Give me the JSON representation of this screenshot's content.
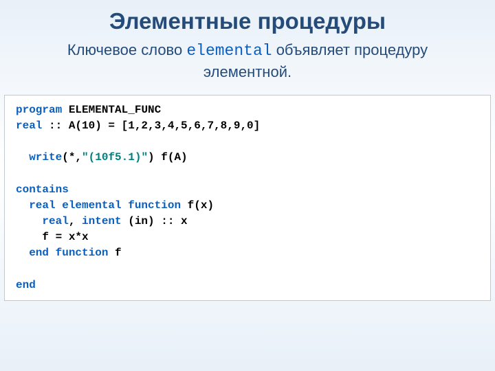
{
  "title": "Элементные процедуры",
  "subtitle_pre": "Ключевое слово ",
  "subtitle_kw": "elemental",
  "subtitle_post": "  объявляет процедуру элементной.",
  "code": {
    "l1a": "program",
    "l1b": " ELEMENTAL_FUNC",
    "l2a": "real",
    "l2b": " :: A(10) = [1,2,3,4,5,6,7,8,9,0]",
    "l3": "",
    "l4a": "  write",
    "l4b": "(*,",
    "l4c": "\"(10f5.1)\"",
    "l4d": ") f(A)",
    "l5": "",
    "l6a": "contains",
    "l7a": "  real elemental function",
    "l7b": " f(x)",
    "l8a": "    real",
    "l8b": ", ",
    "l8c": "intent",
    "l8d": " (in) :: x",
    "l9": "    f = x*x",
    "l10a": "  end function",
    "l10b": " f",
    "l11": "",
    "l12a": "end"
  }
}
